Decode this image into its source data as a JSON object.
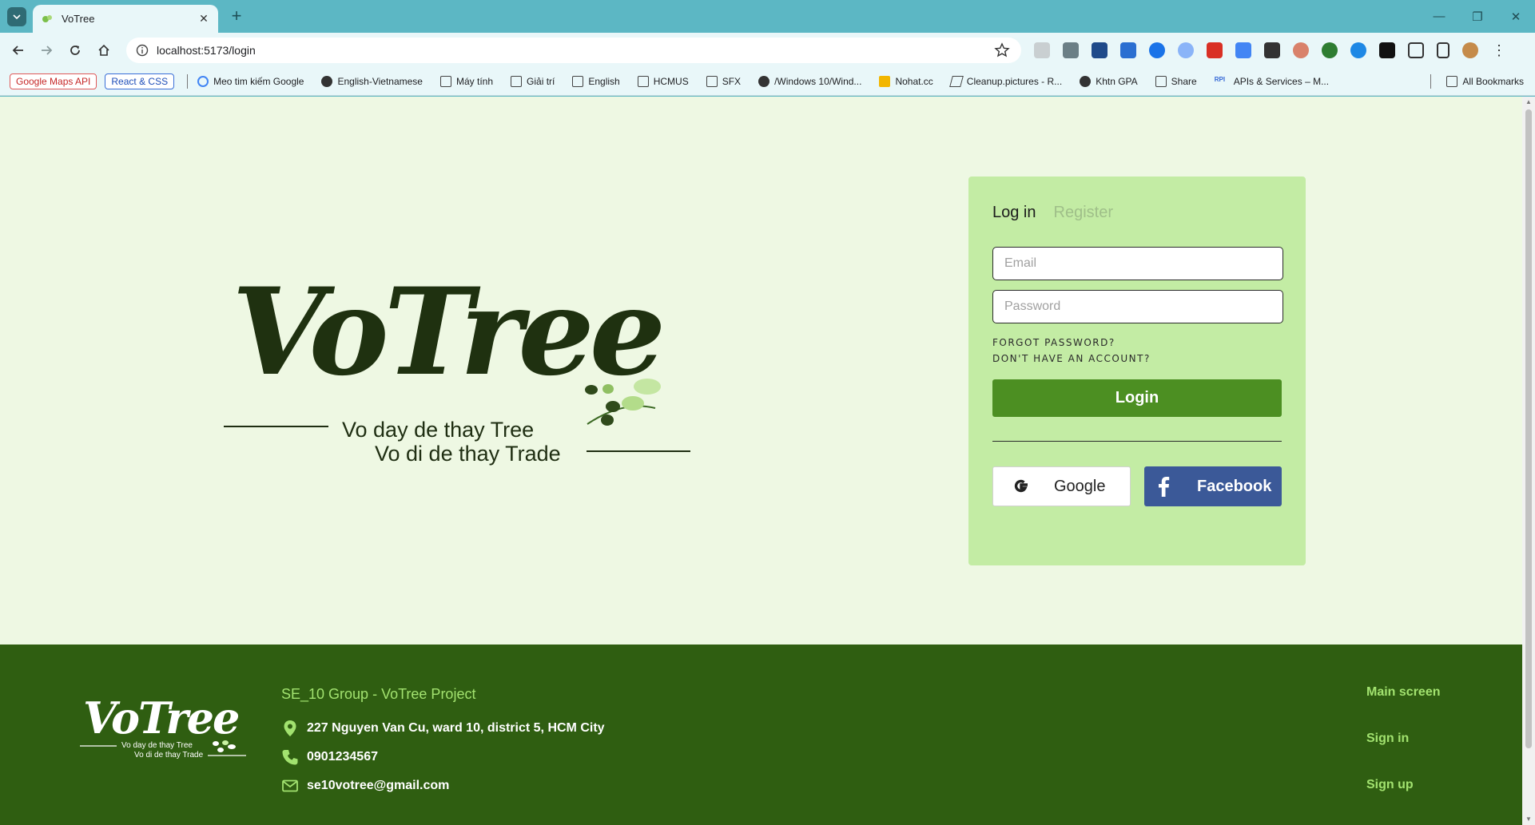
{
  "browser": {
    "tab_title": "VoTree",
    "url": "localhost:5173/login",
    "bookmarks": [
      {
        "label": "Meo tim kiếm Google",
        "icon": "google-icon"
      },
      {
        "label": "English-Vietnamese",
        "icon": "globe-icon"
      },
      {
        "label": "Máy tính",
        "icon": "folder-icon"
      },
      {
        "label": "Giải trí",
        "icon": "folder-icon"
      },
      {
        "label": "English",
        "icon": "folder-icon"
      },
      {
        "label": "HCMUS",
        "icon": "folder-icon"
      },
      {
        "label": "SFX",
        "icon": "folder-icon"
      },
      {
        "label": "/Windows 10/Wind...",
        "icon": "globe-icon"
      },
      {
        "label": "Nohat.cc",
        "icon": "nohat-icon"
      },
      {
        "label": "Cleanup.pictures - R...",
        "icon": "cleanup-icon"
      },
      {
        "label": "Khtn GPA",
        "icon": "globe-icon"
      },
      {
        "label": "Share",
        "icon": "folder-icon"
      },
      {
        "label": "APIs & Services – M...",
        "icon": "api-icon"
      }
    ],
    "bookmark_pills": [
      "Google Maps API",
      "React & CSS"
    ],
    "all_bookmarks": "All Bookmarks"
  },
  "hero": {
    "logo_title": "VoTree",
    "tagline_1": "Vo day de thay Tree",
    "tagline_2": "Vo di de thay Trade"
  },
  "login": {
    "tab_login": "Log in",
    "tab_register": "Register",
    "email_placeholder": "Email",
    "password_placeholder": "Password",
    "forgot": "FORGOT PASSWORD?",
    "no_account": "DON'T HAVE AN ACCOUNT?",
    "login_button": "Login",
    "google_button": "Google",
    "facebook_button": "Facebook"
  },
  "footer": {
    "title": "SE_10 Group - VoTree Project",
    "address": "227 Nguyen Van Cu, ward 10, district 5, HCM City",
    "phone": "0901234567",
    "email": "se10votree@gmail.com",
    "links": [
      "Main screen",
      "Sign in",
      "Sign up"
    ],
    "logo_tagline_1": "Vo day de thay Tree",
    "logo_tagline_2": "Vo di de thay Trade"
  },
  "colors": {
    "accent_green": "#4c8f22",
    "footer_green": "#2f5e11",
    "card_green": "#c3eca4",
    "page_bg": "#eef8e3",
    "facebook_blue": "#3b5998"
  }
}
